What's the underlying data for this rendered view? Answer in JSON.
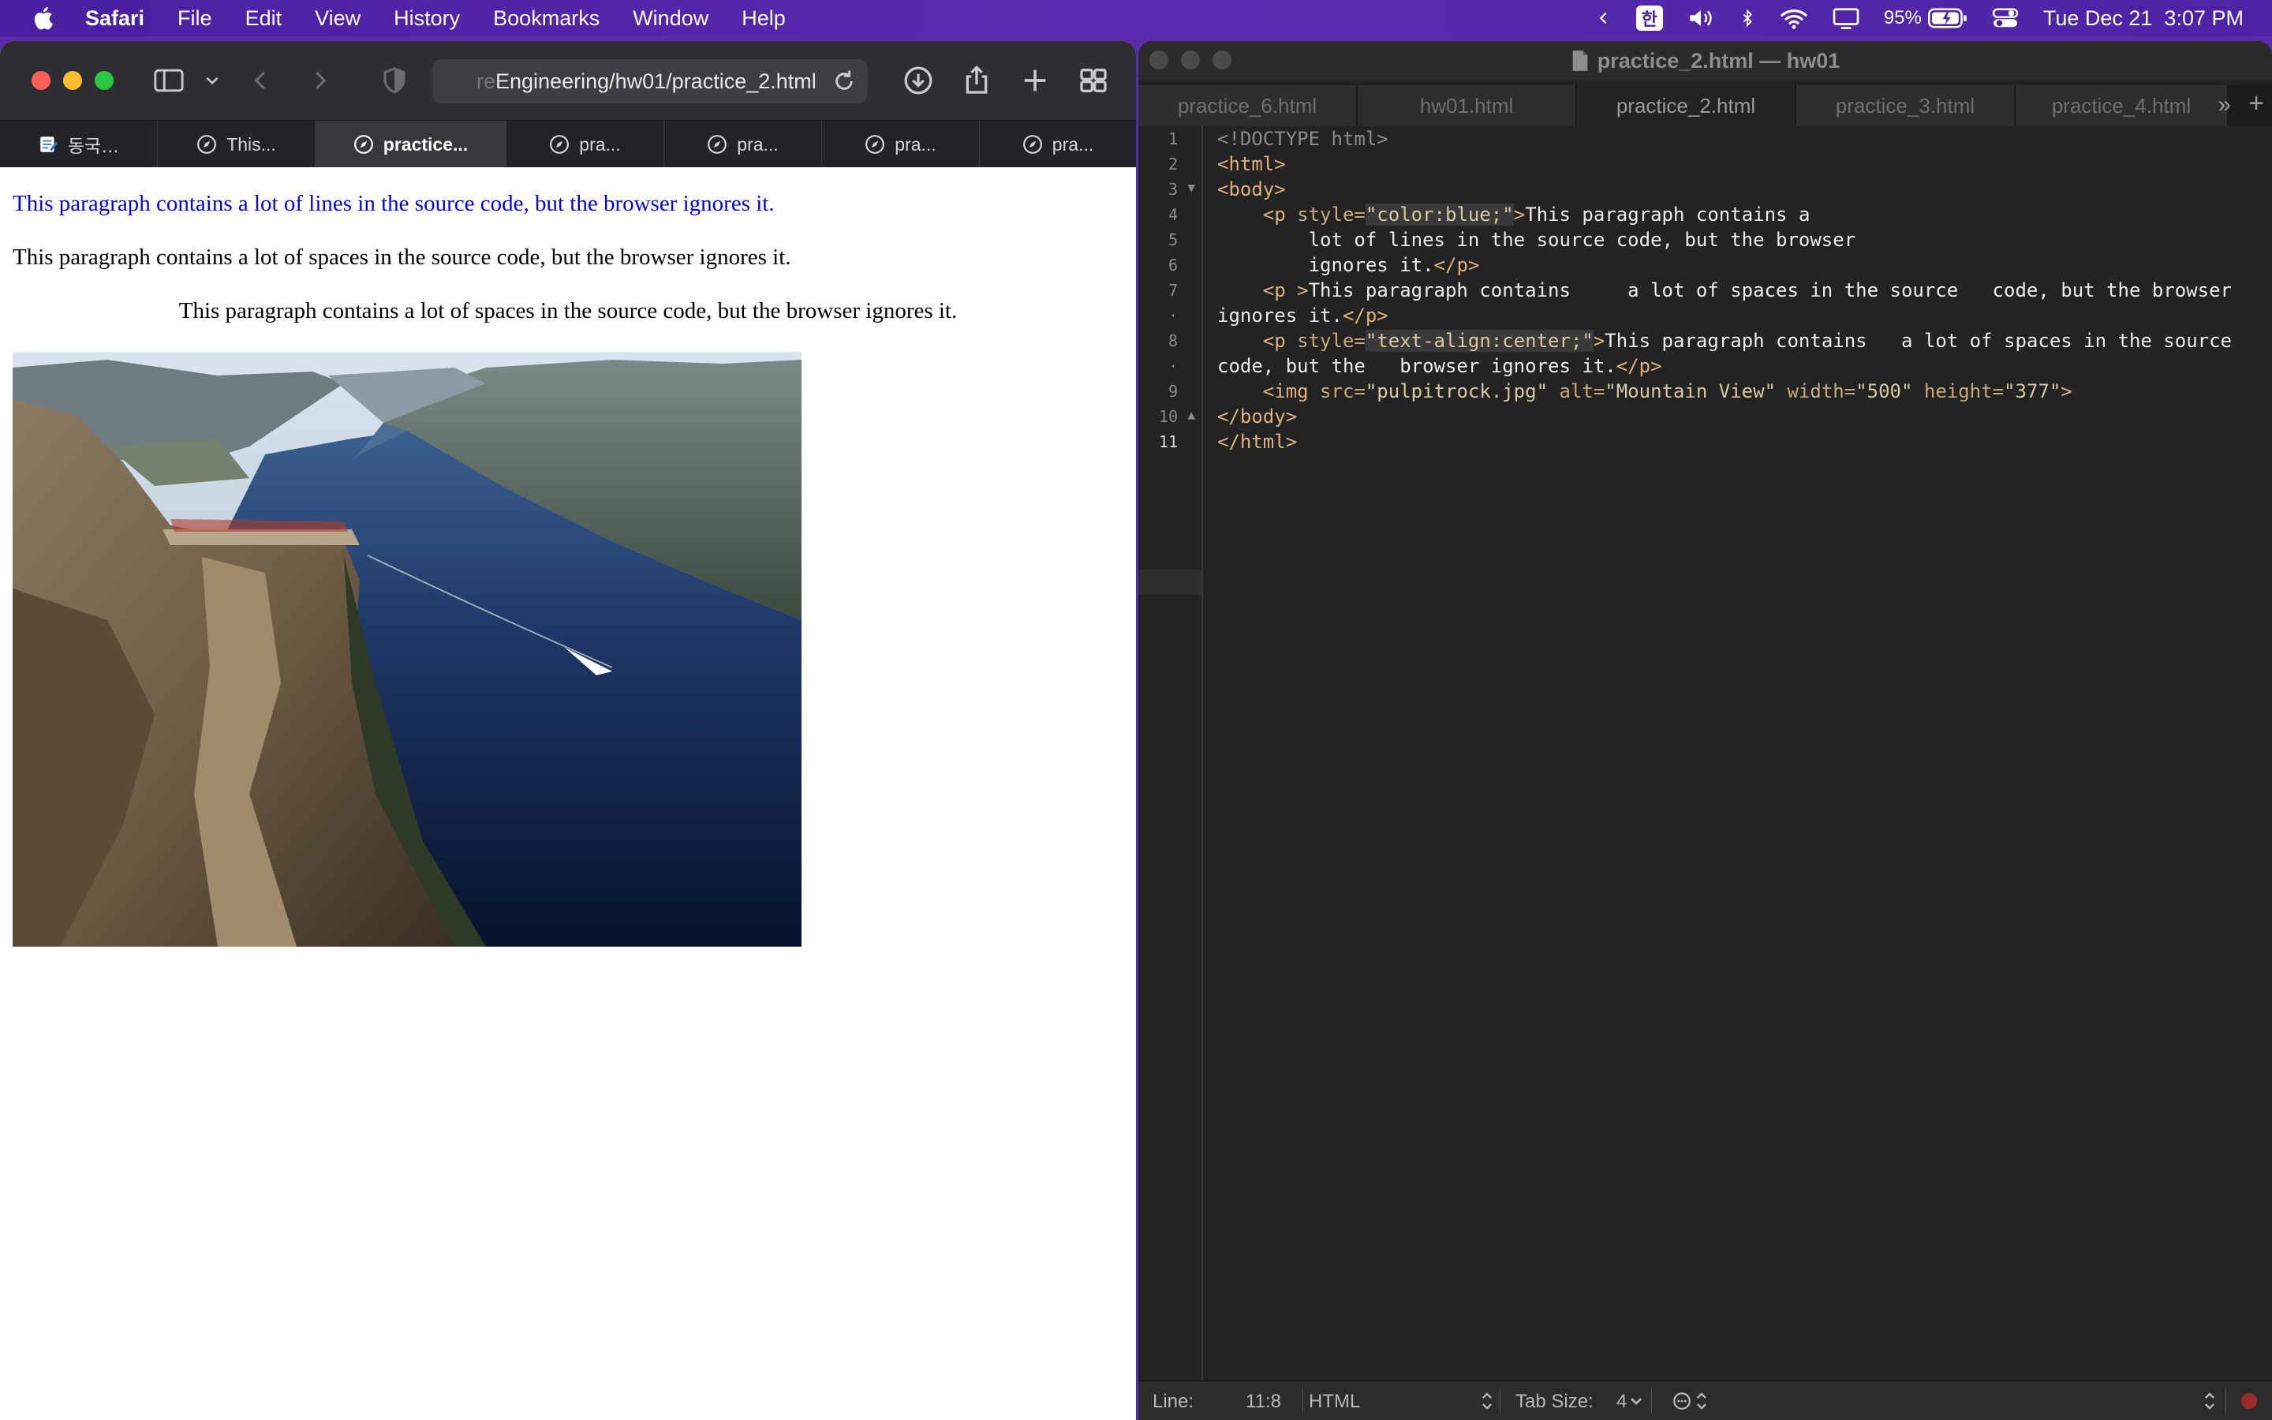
{
  "menubar": {
    "app": "Safari",
    "items": [
      "File",
      "Edit",
      "View",
      "History",
      "Bookmarks",
      "Window",
      "Help"
    ],
    "ime": "한",
    "battery": "95%",
    "clock": "Tue Dec 21  3:07 PM"
  },
  "safari": {
    "address_faded": "re",
    "address": "Engineering/hw01/practice_2.html",
    "tabs": [
      {
        "label": "동국…",
        "icon": "notes-icon"
      },
      {
        "label": "This...",
        "icon": "compass-icon"
      },
      {
        "label": "practice...",
        "icon": "compass-icon"
      },
      {
        "label": "pra...",
        "icon": "compass-icon"
      },
      {
        "label": "pra...",
        "icon": "compass-icon"
      },
      {
        "label": "pra...",
        "icon": "compass-icon"
      },
      {
        "label": "pra...",
        "icon": "compass-icon"
      }
    ],
    "page": {
      "p1": "This paragraph contains a lot of lines in the source code, but the browser ignores it.",
      "p2": "This paragraph contains a lot of spaces in the source code, but the browser ignores it.",
      "p3": "This paragraph contains a lot of spaces in the source code, but the browser ignores it.",
      "image_alt": "Mountain View",
      "p1_color": "#0000ee"
    }
  },
  "editor": {
    "title": "practice_2.html — hw01",
    "tabs": [
      "practice_6.html",
      "hw01.html",
      "practice_2.html",
      "practice_3.html",
      "practice_4.html"
    ],
    "active_tab": "practice_2.html",
    "line_numbers": [
      "1",
      "2",
      "3",
      "4",
      "5",
      "6",
      "7",
      "·",
      "8",
      "·",
      "9",
      "10",
      "11"
    ],
    "code": {
      "l1": "<!DOCTYPE html>",
      "l2": "<html>",
      "l3": "<body>",
      "l4a": "    <p ",
      "l4b": "style=",
      "l4c": "\"color:blue;\"",
      "l4d": ">",
      "l4e": "This paragraph contains a",
      "l5": "        lot of lines in the source code, but the browser",
      "l6a": "        ignores it.",
      "l6b": "</p>",
      "l7a": "    <p >",
      "l7b": "This paragraph contains     a lot of spaces in the source   code, but the browser",
      "l7c": "ignores it.",
      "l7d": "</p>",
      "l8a": "    <p ",
      "l8b": "style=",
      "l8c": "\"text-align:center;\"",
      "l8d": ">",
      "l8e": "This paragraph contains   a lot of spaces in the source",
      "l8f": "code, but the   browser ignores it.",
      "l8g": "</p>",
      "l9a": "    <img ",
      "l9b": "src=",
      "l9c": "\"pulpitrock.jpg\"",
      "l9d": " alt=",
      "l9e": "\"Mountain View\"",
      "l9f": " width=",
      "l9g": "\"500\"",
      "l9h": " height=",
      "l9i": "\"377\"",
      "l9j": ">",
      "l10": "</body>",
      "l11": "</html>"
    },
    "status": {
      "line_label": "Line:",
      "position": "11:8",
      "syntax": "HTML",
      "tab_size": "Tab Size:",
      "tab_value": "4"
    }
  }
}
